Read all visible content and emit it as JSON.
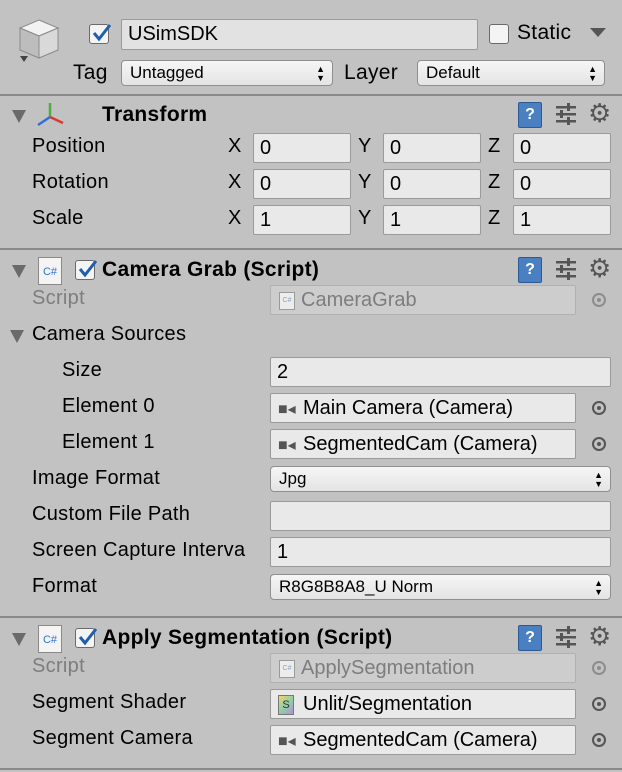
{
  "header": {
    "active": true,
    "object_name": "USimSDK",
    "static_label": "Static",
    "static_checked": false,
    "tag_label": "Tag",
    "tag_value": "Untagged",
    "layer_label": "Layer",
    "layer_value": "Default"
  },
  "transform": {
    "title": "Transform",
    "rows": [
      {
        "label": "Position",
        "x": "0",
        "y": "0",
        "z": "0"
      },
      {
        "label": "Rotation",
        "x": "0",
        "y": "0",
        "z": "0"
      },
      {
        "label": "Scale",
        "x": "1",
        "y": "1",
        "z": "1"
      }
    ],
    "axis_x": "X",
    "axis_y": "Y",
    "axis_z": "Z"
  },
  "camera_grab": {
    "title": "Camera Grab (Script)",
    "enabled": true,
    "script_label": "Script",
    "script_value": "CameraGrab",
    "sources_label": "Camera Sources",
    "size_label": "Size",
    "size_value": "2",
    "element0_label": "Element 0",
    "element0_value": "Main Camera (Camera)",
    "element1_label": "Element 1",
    "element1_value": "SegmentedCam (Camera)",
    "image_format_label": "Image Format",
    "image_format_value": "Jpg",
    "custom_path_label": "Custom File Path",
    "custom_path_value": "",
    "interval_label": "Screen Capture Interva",
    "interval_value": "1",
    "format_label": "Format",
    "format_value": "R8G8B8A8_U Norm"
  },
  "apply_segmentation": {
    "title": "Apply Segmentation (Script)",
    "enabled": true,
    "script_label": "Script",
    "script_value": "ApplySegmentation",
    "shader_label": "Segment Shader",
    "shader_value": "Unlit/Segmentation",
    "camera_label": "Segment Camera",
    "camera_value": "SegmentedCam (Camera)"
  },
  "colors": {
    "panel": "#c2c2c2",
    "field": "#e9e9e9",
    "checkmark": "#1f5fae"
  }
}
